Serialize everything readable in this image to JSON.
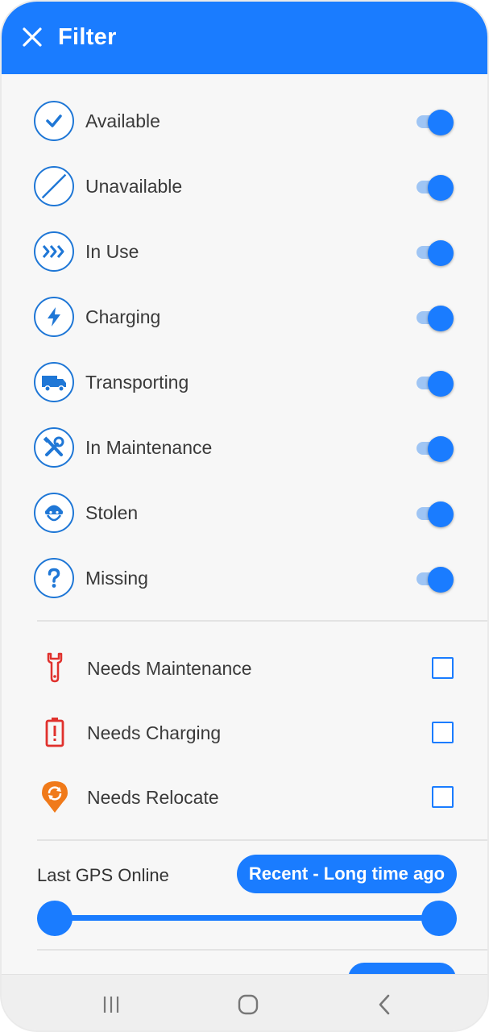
{
  "header": {
    "title": "Filter",
    "close_icon": "close-icon"
  },
  "statuses": [
    {
      "label": "Available",
      "icon": "check-icon",
      "enabled": true
    },
    {
      "label": "Unavailable",
      "icon": "slash-icon",
      "enabled": true
    },
    {
      "label": "In Use",
      "icon": "chevrons-right-icon",
      "enabled": true
    },
    {
      "label": "Charging",
      "icon": "lightning-icon",
      "enabled": true
    },
    {
      "label": "Transporting",
      "icon": "truck-icon",
      "enabled": true
    },
    {
      "label": "In Maintenance",
      "icon": "tools-icon",
      "enabled": true
    },
    {
      "label": "Stolen",
      "icon": "thief-icon",
      "enabled": true
    },
    {
      "label": "Missing",
      "icon": "question-icon",
      "enabled": true
    }
  ],
  "needs": [
    {
      "label": "Needs Maintenance",
      "icon": "wrench-icon",
      "checked": false,
      "color": "#e0312d"
    },
    {
      "label": "Needs Charging",
      "icon": "battery-alert-icon",
      "checked": false,
      "color": "#e0312d"
    },
    {
      "label": "Needs Relocate",
      "icon": "relocate-pin-icon",
      "checked": false,
      "color": "#f07a1a"
    }
  ],
  "gps": {
    "label": "Last GPS Online",
    "range_label": "Recent - Long time ago"
  },
  "colors": {
    "accent": "#1a7cff",
    "icon_blue": "#1f77d6",
    "alert_red": "#e0312d",
    "alert_orange": "#f07a1a"
  },
  "system_nav": [
    "recent-apps-icon",
    "home-icon",
    "back-icon"
  ]
}
